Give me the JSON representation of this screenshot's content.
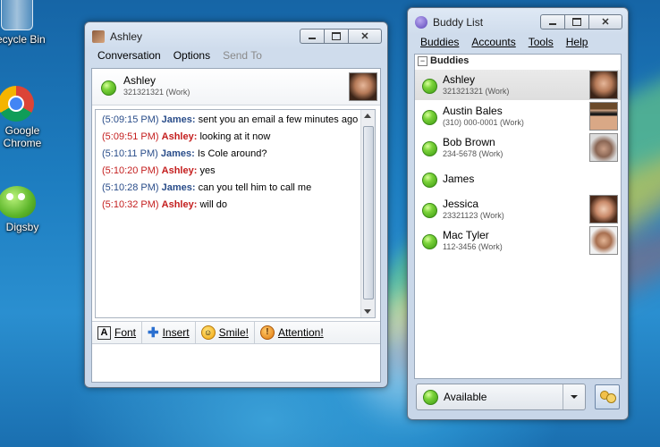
{
  "desktop": {
    "icons": [
      {
        "name": "recycle-bin",
        "label": "Recycle Bin"
      },
      {
        "name": "google-chrome",
        "label": "Google Chrome"
      },
      {
        "name": "digsby",
        "label": "Digsby"
      }
    ]
  },
  "conversation": {
    "title": "Ashley",
    "menu": [
      "Conversation",
      "Options",
      "Send To"
    ],
    "contact": {
      "name": "Ashley",
      "detail": "321321321 (Work)"
    },
    "messages": [
      {
        "time": "(5:09:15 PM)",
        "sender": "James:",
        "text": "sent you an email a few minutes ago"
      },
      {
        "time": "(5:09:51 PM)",
        "sender": "Ashley:",
        "text": "looking at it now"
      },
      {
        "time": "(5:10:11 PM)",
        "sender": "James:",
        "text": "Is Cole around?"
      },
      {
        "time": "(5:10:20 PM)",
        "sender": "Ashley:",
        "text": "yes"
      },
      {
        "time": "(5:10:28 PM)",
        "sender": "James:",
        "text": "can you tell him to call me"
      },
      {
        "time": "(5:10:32 PM)",
        "sender": "Ashley:",
        "text": "will do"
      }
    ],
    "format_bar": [
      "Font",
      "Insert",
      "Smile!",
      "Attention!"
    ],
    "input_value": ""
  },
  "buddy_list": {
    "title": "Buddy List",
    "menu": [
      "Buddies",
      "Accounts",
      "Tools",
      "Help"
    ],
    "group": "Buddies",
    "buddies": [
      {
        "name": "Ashley",
        "detail": "321321321 (Work)"
      },
      {
        "name": "Austin Bales",
        "detail": "(310) 000-0001 (Work)"
      },
      {
        "name": "Bob Brown",
        "detail": "234-5678 (Work)"
      },
      {
        "name": "James",
        "detail": ""
      },
      {
        "name": "Jessica",
        "detail": "23321123 (Work)"
      },
      {
        "name": "Mac Tyler",
        "detail": "112-3456 (Work)"
      }
    ],
    "status": "Available"
  },
  "colors": {
    "james": "#2a4d8a",
    "ashley": "#c41e1e",
    "online": "#5cbf24"
  }
}
